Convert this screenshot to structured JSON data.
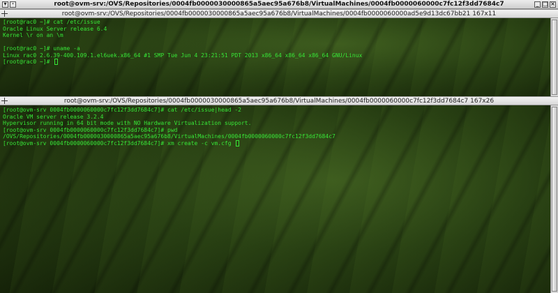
{
  "window": {
    "title": "root@ovm-srv:/OVS/Repositories/0004fb0000030000865a5aec95a676b8/VirtualMachines/0004fb0000060000c7fc12f3dd7684c7"
  },
  "pane_top": {
    "title": "root@ovm-srv:/OVS/Repositories/0004fb0000030000865a5aec95a676b8/VirtualMachines/0004fb0000060000ad5e9d13dc67bb21 167x11",
    "lines": [
      "[root@rac0 ~]# cat /etc/issue",
      "Oracle Linux Server release 6.4",
      "Kernel \\r on an \\m",
      "",
      "[root@rac0 ~]# uname -a",
      "Linux rac0 2.6.39-400.109.1.el6uek.x86_64 #1 SMP Tue Jun 4 23:21:51 PDT 2013 x86_64 x86_64 x86_64 GNU/Linux"
    ],
    "prompt": "[root@rac0 ~]# "
  },
  "pane_bottom": {
    "title": "root@ovm-srv:/OVS/Repositories/0004fb0000030000865a5aec95a676b8/VirtualMachines/0004fb0000060000c7fc12f3dd7684c7 167x26",
    "lines": [
      "[root@ovm-srv 0004fb0000060000c7fc12f3dd7684c7]# cat /etc/issue|head -2",
      "Oracle VM server release 3.2.4",
      "Hypervisor running in 64 bit mode with NO Hardware Virtualization support.",
      "[root@ovm-srv 0004fb0000060000c7fc12f3dd7684c7]# pwd",
      "/OVS/Repositories/0004fb0000030000865a5aec95a676b8/VirtualMachines/0004fb0000060000c7fc12f3dd7684c7"
    ],
    "prompt": "[root@ovm-srv 0004fb0000060000c7fc12f3dd7684c7]# xm create -c vm.cfg "
  },
  "colors": {
    "terminal_text": "#37e637",
    "title_bar": "#dcdcdc"
  },
  "icons": [
    "window-menu-icon",
    "sticky-icon",
    "minimize-icon",
    "maximize-icon",
    "close-icon",
    "pane-grip-icon"
  ]
}
